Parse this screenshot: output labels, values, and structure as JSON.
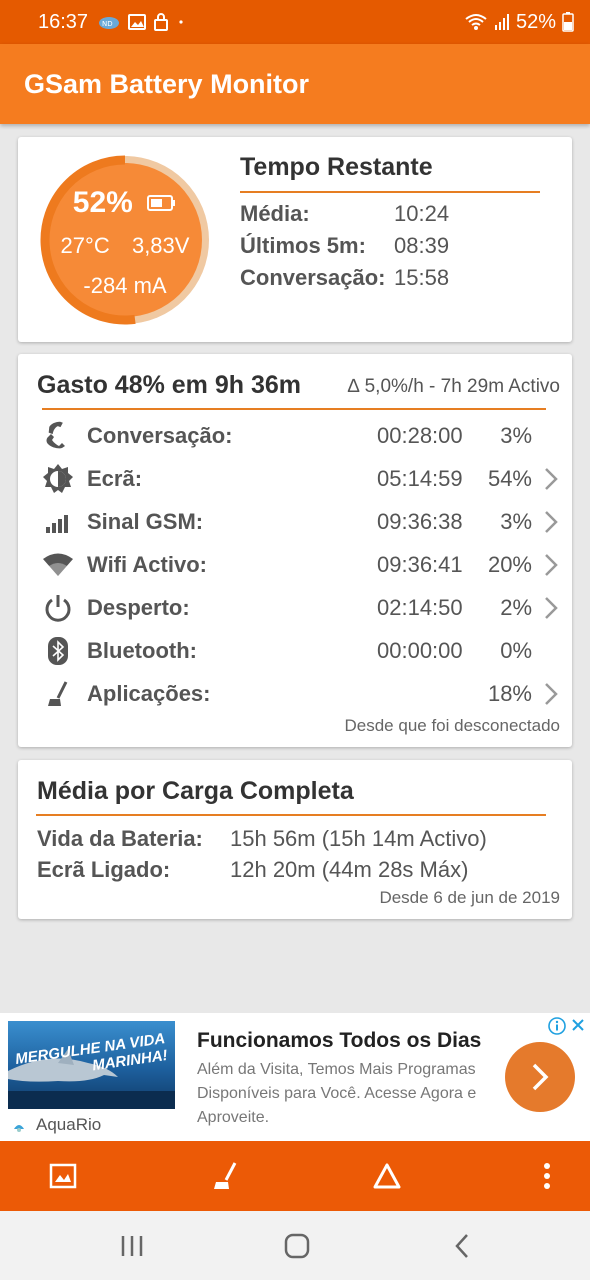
{
  "status": {
    "time": "16:37",
    "battery_pct": "52%"
  },
  "app": {
    "title": "GSam Battery Monitor"
  },
  "gauge": {
    "percent": "52%",
    "level": 0.52,
    "temp": "27°C",
    "voltage": "3,83V",
    "current": "-284 mA"
  },
  "remaining": {
    "title": "Tempo Restante",
    "rows": [
      {
        "label": "Média:",
        "value": "10:24"
      },
      {
        "label": "Últimos 5m:",
        "value": "08:39"
      },
      {
        "label": "Conversação:",
        "value": "15:58"
      }
    ]
  },
  "usage": {
    "title": "Gasto 48% em 9h 36m",
    "rate": "∆ 5,0%/h - 7h 29m Activo",
    "items": [
      {
        "icon": "phone-icon",
        "label": "Conversação:",
        "time": "00:28:00",
        "pct": "3%",
        "chevron": false
      },
      {
        "icon": "screen-brightness-icon",
        "label": "Ecrã:",
        "time": "05:14:59",
        "pct": "54%",
        "chevron": true
      },
      {
        "icon": "signal-bars-icon",
        "label": "Sinal GSM:",
        "time": "09:36:38",
        "pct": "3%",
        "chevron": true
      },
      {
        "icon": "wifi-icon",
        "label": "Wifi Activo:",
        "time": "09:36:41",
        "pct": "20%",
        "chevron": true
      },
      {
        "icon": "power-icon",
        "label": "Desperto:",
        "time": "02:14:50",
        "pct": "2%",
        "chevron": true
      },
      {
        "icon": "bluetooth-icon",
        "label": "Bluetooth:",
        "time": "00:00:00",
        "pct": "0%",
        "chevron": false
      },
      {
        "icon": "apps-broom-icon",
        "label": "Aplicações:",
        "time": "",
        "pct": "18%",
        "chevron": true
      }
    ],
    "since": "Desde que foi desconectado"
  },
  "full_charge": {
    "title": "Média por Carga Completa",
    "rows": [
      {
        "label": "Vida da Bateria:",
        "value": "15h 56m (15h 14m Activo)"
      },
      {
        "label": "Ecrã Ligado:",
        "value": "12h 20m (44m 28s Máx)"
      }
    ],
    "since": "Desde 6 de jun de 2019"
  },
  "ad": {
    "image_text": "MERGULHE NA VIDA MARINHA!",
    "brand": "AquaRio",
    "title": "Funcionamos Todos os Dias",
    "body": "Além da Visita, Temos Mais Programas Disponíveis para Você. Acesse Agora e Aproveite."
  },
  "colors": {
    "status_bar": "#e55a00",
    "app_bar": "#f57c1f",
    "accent": "#e67e22",
    "toolbar": "#ec5a06"
  }
}
